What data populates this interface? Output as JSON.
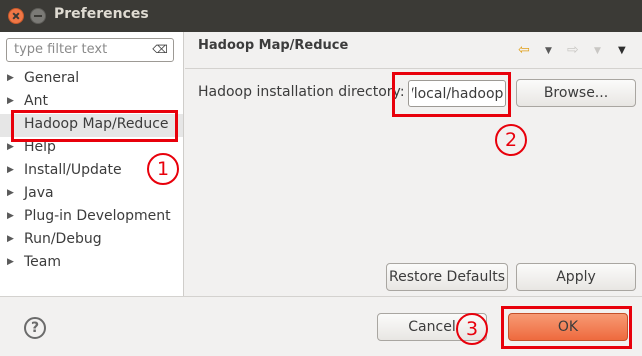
{
  "window": {
    "title": "Preferences",
    "close_glyph": "",
    "minimize_glyph": ""
  },
  "filter": {
    "placeholder": "type filter text",
    "clear_icon": "⌫"
  },
  "tree": {
    "items": [
      {
        "label": "General",
        "has_children": true
      },
      {
        "label": "Ant",
        "has_children": true
      },
      {
        "label": "Hadoop Map/Reduce",
        "has_children": false,
        "selected": true
      },
      {
        "label": "Help",
        "has_children": true
      },
      {
        "label": "Install/Update",
        "has_children": true
      },
      {
        "label": "Java",
        "has_children": true
      },
      {
        "label": "Plug-in Development",
        "has_children": true
      },
      {
        "label": "Run/Debug",
        "has_children": true
      },
      {
        "label": "Team",
        "has_children": true
      }
    ],
    "arrow_glyph": "▶"
  },
  "page": {
    "title": "Hadoop Map/Reduce",
    "nav": {
      "back_icon": "⇦",
      "back_menu_icon": "▼",
      "forward_icon": "⇨",
      "forward_menu_icon": "▼",
      "view_menu_icon": "▼"
    },
    "dir_label": "Hadoop installation directory:",
    "dir_value": "/local/hadoop",
    "browse_label": "Browse...",
    "restore_label": "Restore Defaults",
    "apply_label": "Apply"
  },
  "footer": {
    "help_icon": "?",
    "cancel_label": "Cancel",
    "ok_label": "OK"
  },
  "annotations": {
    "step1": "1",
    "step2": "2",
    "step3": "3",
    "color": "#e8000b"
  }
}
